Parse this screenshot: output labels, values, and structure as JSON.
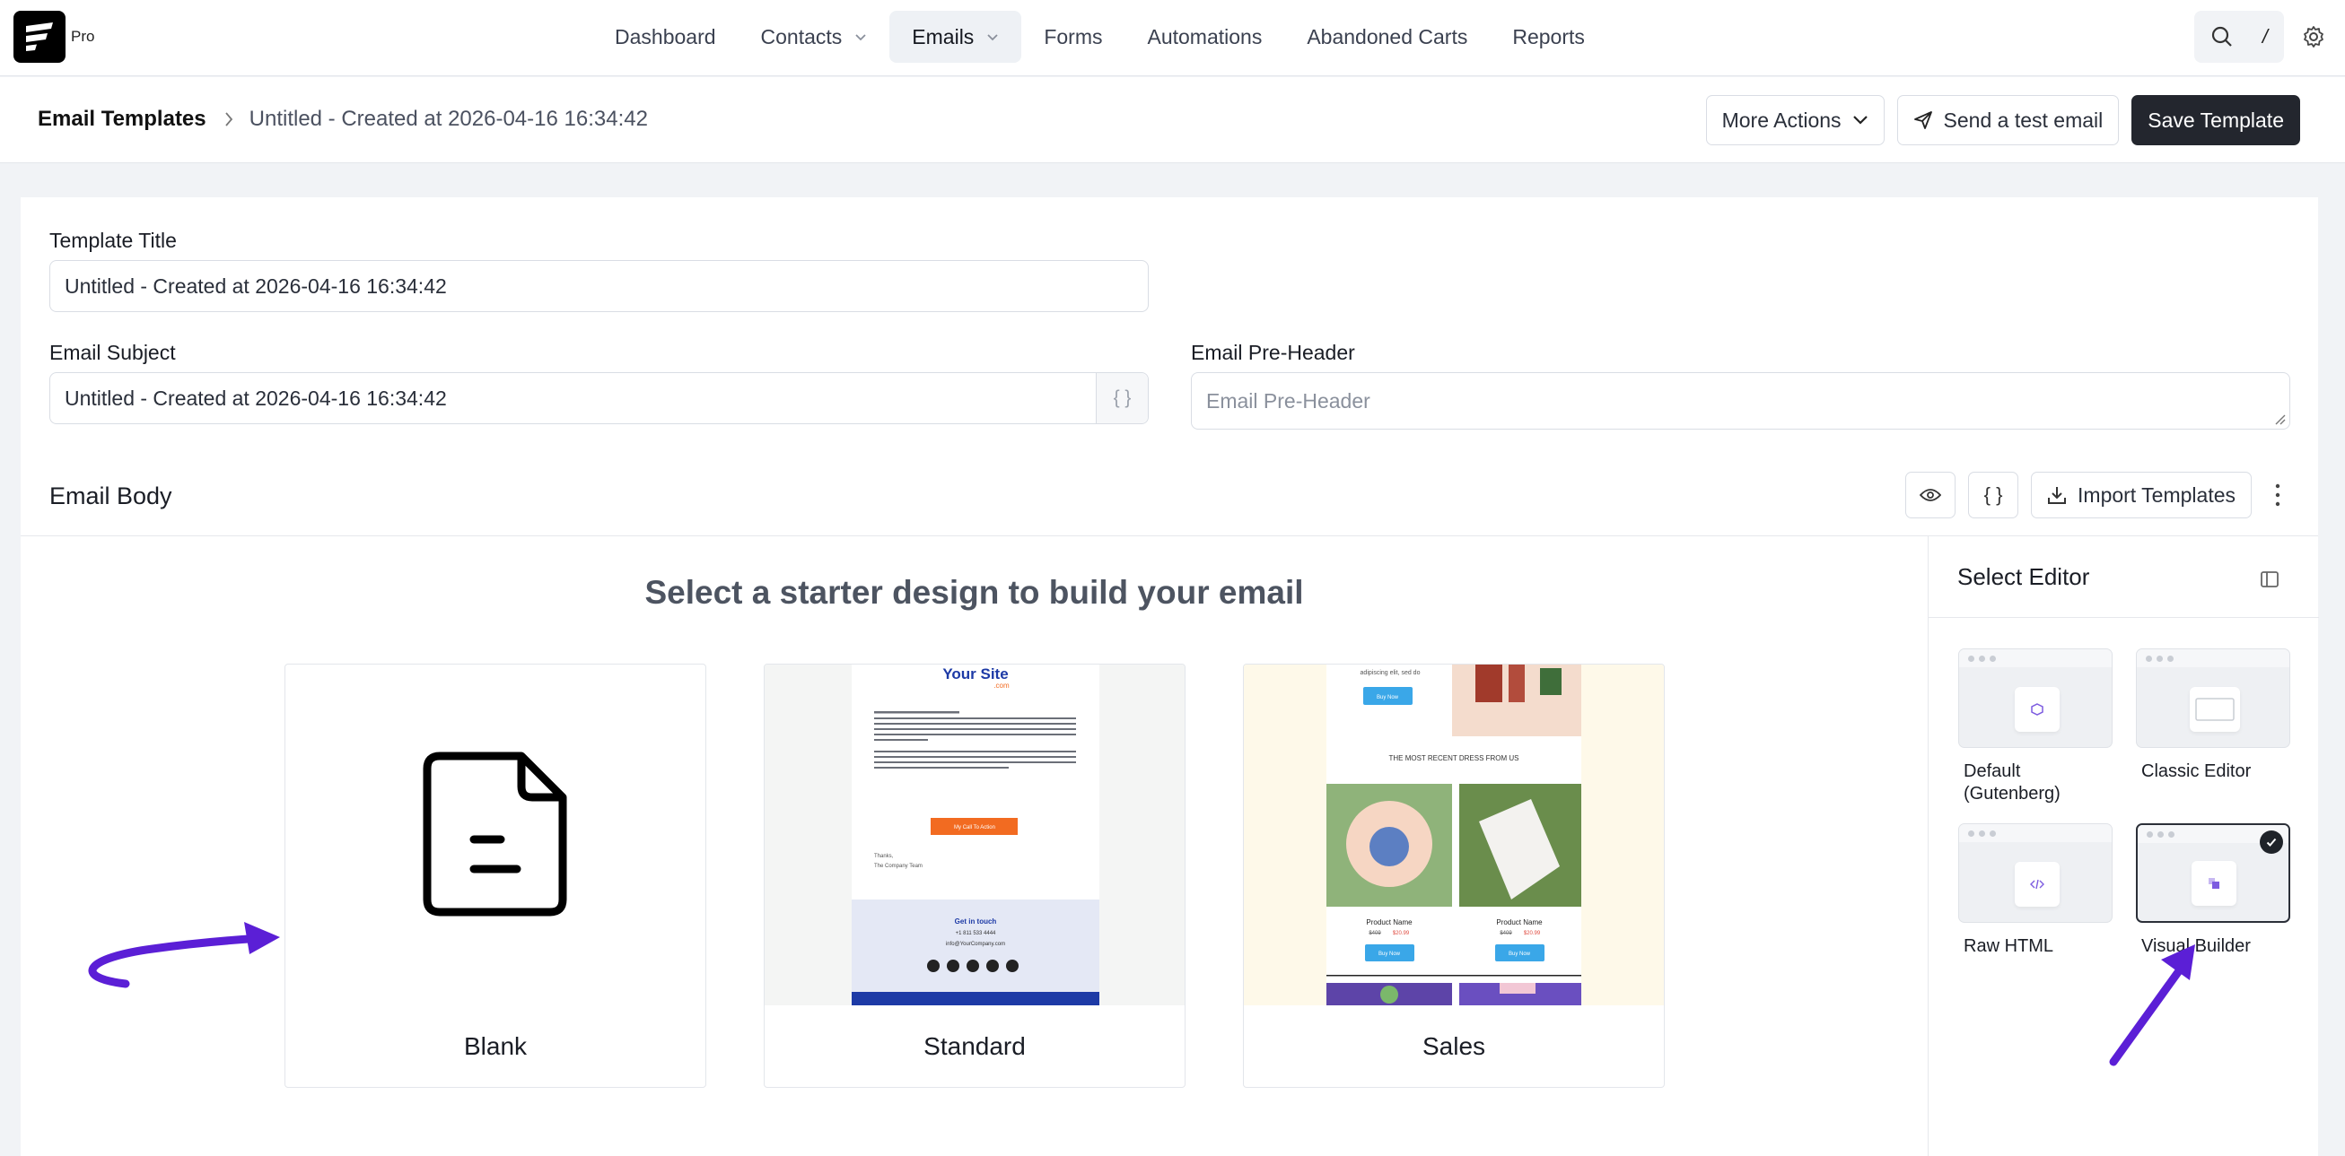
{
  "app": {
    "logo_tag": "Pro"
  },
  "nav": {
    "items": [
      {
        "label": "Dashboard",
        "has_dropdown": false,
        "active": false
      },
      {
        "label": "Contacts",
        "has_dropdown": true,
        "active": false
      },
      {
        "label": "Emails",
        "has_dropdown": true,
        "active": true
      },
      {
        "label": "Forms",
        "has_dropdown": false,
        "active": false
      },
      {
        "label": "Automations",
        "has_dropdown": false,
        "active": false
      },
      {
        "label": "Abandoned Carts",
        "has_dropdown": false,
        "active": false
      },
      {
        "label": "Reports",
        "has_dropdown": false,
        "active": false
      }
    ],
    "search_shortcut": "/"
  },
  "breadcrumb": {
    "root": "Email Templates",
    "current": "Untitled - Created at 2026-04-16 16:34:42"
  },
  "actions": {
    "more_actions": "More Actions",
    "send_test": "Send a test email",
    "save": "Save Template"
  },
  "form": {
    "template_title_label": "Template Title",
    "template_title_value": "Untitled - Created at 2026-04-16 16:34:42",
    "subject_label": "Email Subject",
    "subject_value": "Untitled - Created at 2026-04-16 16:34:42",
    "subject_addon": "{ }",
    "preheader_label": "Email Pre-Header",
    "preheader_placeholder": "Email Pre-Header"
  },
  "email_body": {
    "title": "Email Body",
    "code_button": "{ }",
    "import_button": "Import Templates"
  },
  "starter": {
    "heading": "Select a starter design to build your email",
    "templates": [
      {
        "name": "Blank"
      },
      {
        "name": "Standard"
      },
      {
        "name": "Sales"
      }
    ]
  },
  "editor_panel": {
    "title": "Select Editor",
    "options": [
      {
        "label": "Default (Gutenberg)",
        "selected": false
      },
      {
        "label": "Classic Editor",
        "selected": false
      },
      {
        "label": "Raw HTML",
        "selected": false
      },
      {
        "label": "Visual Builder",
        "selected": true
      }
    ]
  },
  "thumb_standard": {
    "site": "Your Site",
    "site_sub": ".com",
    "cta": "My Call To Action",
    "thanks": "Thanks,",
    "team": "The Company Team",
    "get_in_touch": "Get in touch",
    "phone": "+1 811 533 4444",
    "email": "info@YourCompany.com"
  },
  "thumb_sales": {
    "top_text": "adipiscing elit, sed do",
    "buy_now": "Buy Now",
    "heading": "THE MOST RECENT DRESS FROM US",
    "product_name": "Product Name",
    "old_price": "$409",
    "new_price": "$20.99"
  },
  "colors": {
    "accent_purple": "#5b1fd6",
    "primary_dark": "#23262e",
    "standard_orange": "#f26b21",
    "standard_blue": "#1d3aa6",
    "sales_bg": "#fef9e9",
    "sales_button": "#3aa7e8"
  }
}
